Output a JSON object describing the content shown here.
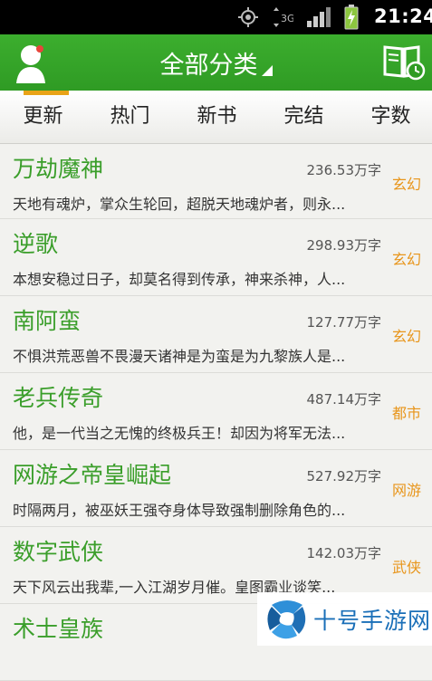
{
  "status_bar": {
    "time": "21:24",
    "network_label": "3G",
    "icons": [
      "gps-icon",
      "3g-data-icon",
      "signal-icon",
      "battery-charging-icon"
    ]
  },
  "header": {
    "title": "全部分类",
    "left_icon": "user-avatar-icon",
    "right_icon": "bookshelf-icon",
    "color": "#35a528"
  },
  "tabs": [
    {
      "label": "更新",
      "active": true
    },
    {
      "label": "热门",
      "active": false
    },
    {
      "label": "新书",
      "active": false
    },
    {
      "label": "完结",
      "active": false
    },
    {
      "label": "字数",
      "active": false
    }
  ],
  "books": [
    {
      "title": "万劫魔神",
      "words": "236.53万字",
      "desc": "天地有魂炉，掌众生轮回，超脱天地魂炉者，则永...",
      "category": "玄幻"
    },
    {
      "title": "逆歌",
      "words": "298.93万字",
      "desc": "本想安稳过日子，却莫名得到传承，神来杀神，人...",
      "category": "玄幻"
    },
    {
      "title": "南阿蛮",
      "words": "127.77万字",
      "desc": "不惧洪荒恶兽不畏漫天诸神是为蛮是为九黎族人是...",
      "category": "玄幻"
    },
    {
      "title": "老兵传奇",
      "words": "487.14万字",
      "desc": "他，是一代当之无愧的终极兵王！却因为将军无法...",
      "category": "都市"
    },
    {
      "title": "网游之帝皇崛起",
      "words": "527.92万字",
      "desc": "时隔两月，被巫妖王强夺身体导致强制删除角色的...",
      "category": "网游"
    },
    {
      "title": "数字武侠",
      "words": "142.03万字",
      "desc": "天下风云出我辈,一入江湖岁月催。皇图霸业谈笑...",
      "category": "武侠"
    },
    {
      "title": "术士皇族",
      "words": "",
      "desc": "",
      "category": ""
    }
  ],
  "watermark": {
    "text": "十号手游网"
  },
  "colors": {
    "title_green": "#3a9e2a",
    "category_orange": "#e8951a",
    "tab_indicator": "#e8a317"
  }
}
